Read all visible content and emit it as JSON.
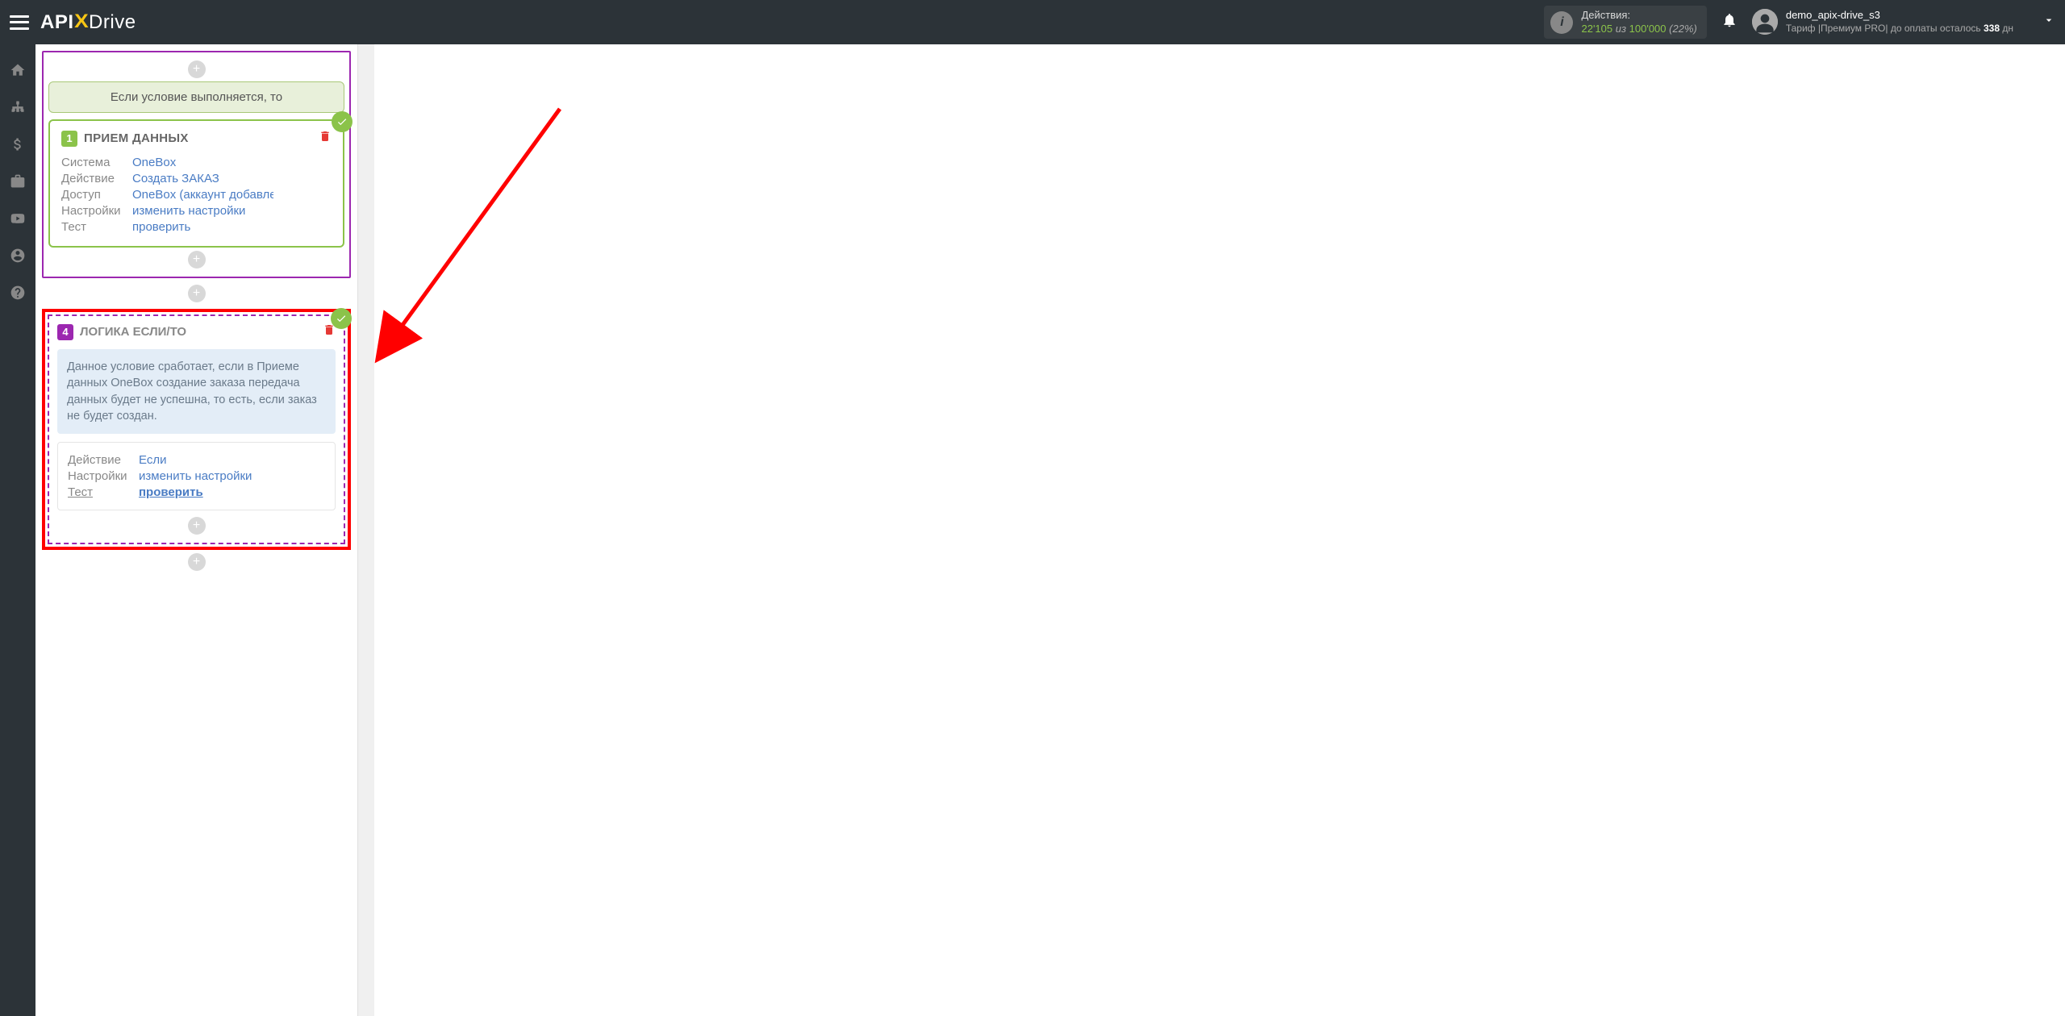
{
  "header": {
    "actions_label": "Действия:",
    "actions_current": "22'105",
    "actions_of": "из",
    "actions_total": "100'000",
    "actions_pct": "(22%)",
    "username": "demo_apix-drive_s3",
    "tariff_prefix": "Тариф |Премиум PRO|  до оплаты осталось ",
    "tariff_days": "338",
    "tariff_suffix": " дн"
  },
  "banner": {
    "condition_then": "Если условие выполняется, то"
  },
  "step1": {
    "num": "1",
    "title": "ПРИЕМ ДАННЫХ",
    "labels": {
      "system": "Система",
      "action": "Действие",
      "access": "Доступ",
      "settings": "Настройки",
      "test": "Тест"
    },
    "values": {
      "system": "OneBox",
      "action": "Создать ЗАКАЗ",
      "access": "OneBox (аккаунт добавлен)",
      "settings": "изменить настройки",
      "test": "проверить"
    }
  },
  "step4": {
    "num": "4",
    "title": "ЛОГИКА ЕСЛИ/ТО",
    "description": "Данное условие сработает, если в Приеме данных OneBox создание заказа передача данных будет не успешна, то есть, если заказ не будет создан.",
    "labels": {
      "action": "Действие",
      "settings": "Настройки",
      "test": "Тест"
    },
    "values": {
      "action": "Если",
      "settings": "изменить настройки",
      "test": "проверить"
    }
  }
}
